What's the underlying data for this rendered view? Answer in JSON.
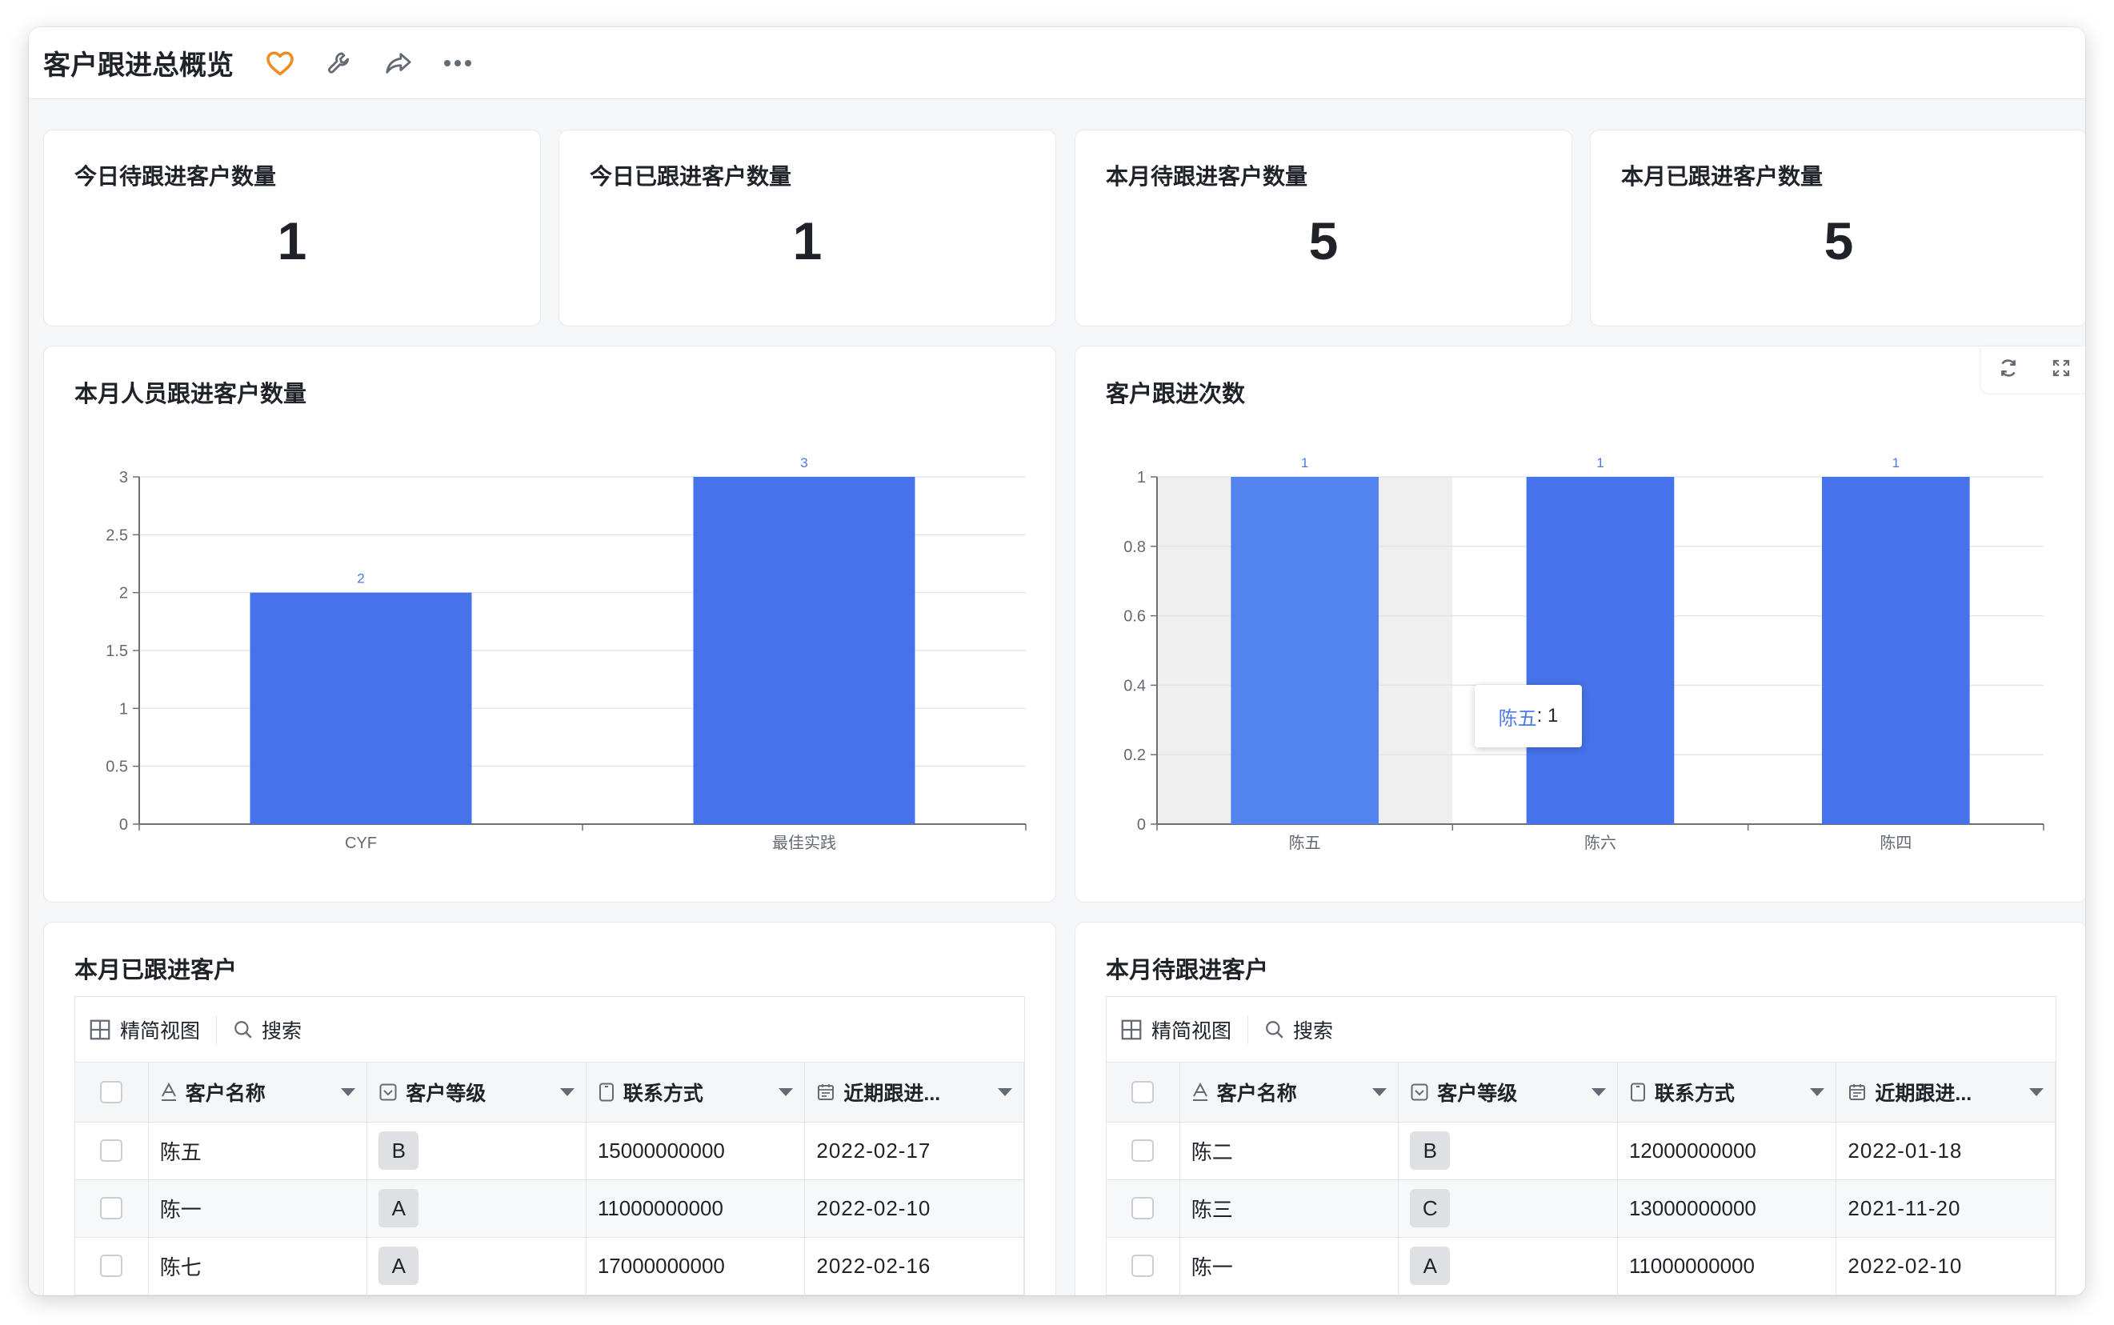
{
  "header": {
    "title": "客户跟进总概览"
  },
  "kpis": [
    {
      "label": "今日待跟进客户数量",
      "value": "1"
    },
    {
      "label": "今日已跟进客户数量",
      "value": "1"
    },
    {
      "label": "本月待跟进客户数量",
      "value": "5"
    },
    {
      "label": "本月已跟进客户数量",
      "value": "5"
    }
  ],
  "charts": {
    "left_title": "本月人员跟进客户数量",
    "right_title": "客户跟进次数",
    "tooltip": {
      "name": "陈五",
      "value": ": 1"
    }
  },
  "chart_data": [
    {
      "type": "bar",
      "title": "本月人员跟进客户数量",
      "categories": [
        "CYF",
        "最佳实践"
      ],
      "values": [
        2,
        3
      ],
      "ylim": [
        0,
        3
      ],
      "yticks": [
        "0",
        "0.5",
        "1",
        "1.5",
        "2",
        "2.5",
        "3"
      ],
      "grid": true,
      "color": "#4673ea"
    },
    {
      "type": "bar",
      "title": "客户跟进次数",
      "categories": [
        "陈五",
        "陈六",
        "陈四"
      ],
      "values": [
        1,
        1,
        1
      ],
      "ylim": [
        0,
        1
      ],
      "yticks": [
        "0",
        "0.2",
        "0.4",
        "0.6",
        "0.8",
        "1"
      ],
      "grid": true,
      "color": "#4673ea",
      "highlight_color": "#5283ee"
    }
  ],
  "tables": {
    "followed": {
      "title": "本月已跟进客户",
      "toolbar": {
        "view": "精简视图",
        "search": "搜索"
      },
      "columns": [
        "客户名称",
        "客户等级",
        "联系方式",
        "近期跟进..."
      ],
      "rows": [
        {
          "name": "陈五",
          "level": "B",
          "phone": "15000000000",
          "date": "2022-02-17"
        },
        {
          "name": "陈一",
          "level": "A",
          "phone": "11000000000",
          "date": "2022-02-10"
        },
        {
          "name": "陈七",
          "level": "A",
          "phone": "17000000000",
          "date": "2022-02-16"
        }
      ]
    },
    "pending": {
      "title": "本月待跟进客户",
      "toolbar": {
        "view": "精简视图",
        "search": "搜索"
      },
      "columns": [
        "客户名称",
        "客户等级",
        "联系方式",
        "近期跟进..."
      ],
      "rows": [
        {
          "name": "陈二",
          "level": "B",
          "phone": "12000000000",
          "date": "2022-01-18"
        },
        {
          "name": "陈三",
          "level": "C",
          "phone": "13000000000",
          "date": "2021-11-20"
        },
        {
          "name": "陈一",
          "level": "A",
          "phone": "11000000000",
          "date": "2022-02-10"
        }
      ]
    }
  },
  "colors": {
    "accent": "#4673ea",
    "favorite": "#f08c24"
  },
  "icons": [
    "heart-icon",
    "wrench-icon",
    "share-icon",
    "more-icon",
    "refresh-icon",
    "fullscreen-icon",
    "grid-view-icon",
    "search-icon",
    "text-field-icon",
    "select-field-icon",
    "phone-field-icon",
    "date-field-icon"
  ]
}
